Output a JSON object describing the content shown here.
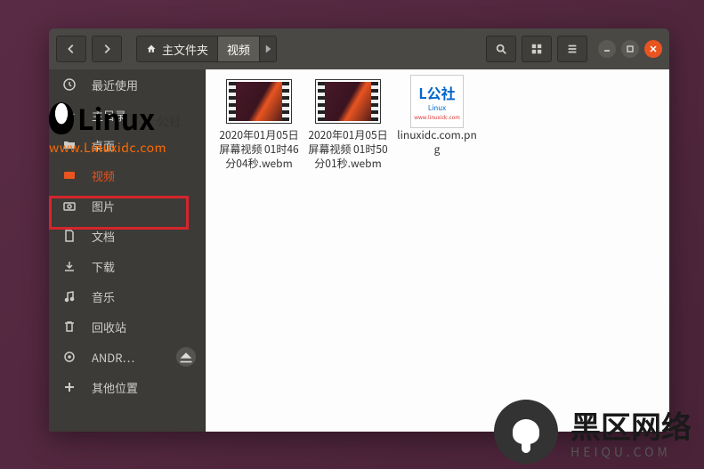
{
  "path": {
    "home_label": "主文件夹",
    "current": "视频"
  },
  "sidebar": {
    "items": [
      {
        "id": "recent",
        "label": "最近使用",
        "icon": "clock"
      },
      {
        "id": "home",
        "label": "主目录",
        "icon": "home"
      },
      {
        "id": "desktop",
        "label": "桌面",
        "icon": "folder"
      },
      {
        "id": "videos",
        "label": "视频",
        "icon": "video",
        "active": true
      },
      {
        "id": "pictures",
        "label": "图片",
        "icon": "camera"
      },
      {
        "id": "documents",
        "label": "文档",
        "icon": "doc"
      },
      {
        "id": "downloads",
        "label": "下载",
        "icon": "download"
      },
      {
        "id": "music",
        "label": "音乐",
        "icon": "music"
      },
      {
        "id": "trash",
        "label": "回收站",
        "icon": "trash"
      },
      {
        "id": "drive",
        "label": "ANDR…",
        "icon": "drive",
        "ejectable": true
      },
      {
        "id": "other",
        "label": "其他位置",
        "icon": "plus"
      }
    ]
  },
  "files": [
    {
      "name": "2020年01月05日 屏幕视频 01时46分04秒.webm",
      "type": "video"
    },
    {
      "name": "2020年01月05日 屏幕视频 01时50分01秒.webm",
      "type": "video"
    },
    {
      "name": "linuxidc.com.png",
      "type": "image"
    }
  ],
  "watermark": {
    "linux_title": "Linux",
    "linux_suffix": "公社",
    "linux_url": "www.Linuxidc.com",
    "heiqu_title": "黑区网络",
    "heiqu_sub": "HEIQU.COM"
  }
}
